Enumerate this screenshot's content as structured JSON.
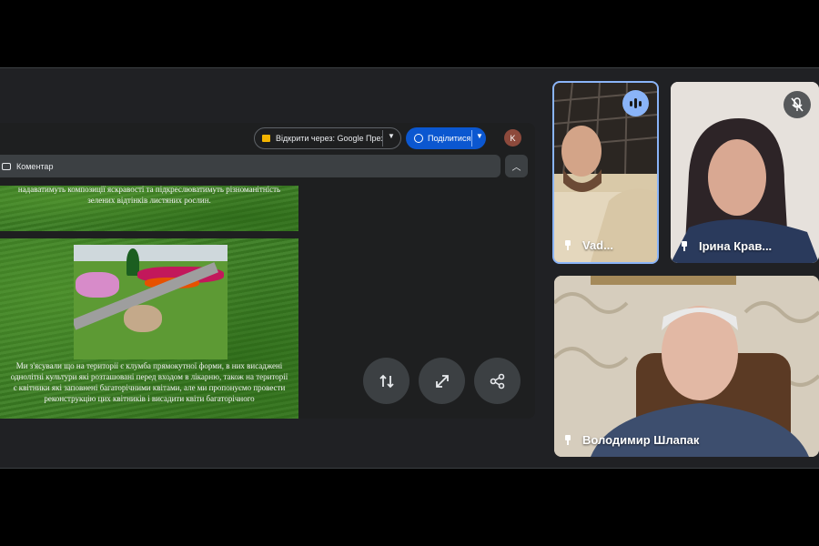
{
  "presentation": {
    "open_with_label": "Відкрити через: Google Презентації",
    "share_label": "Поділитися",
    "account_initial": "K",
    "comment_label": "Коментар",
    "slide1_text": "надаватимуть композиції яскравості та підкреслюватимуть різноманітність зелених відтінків листяних рослин.",
    "slide2_text": "Ми з'ясували що на території є клумба прямокутної форми, в них висаджені однолітні культури які розташовані перед входом в лікарню, також на території є квітники які заповнені багаторічними квітами, але ми пропонуємо провести реконструкцію цих квітників і висадити квіти багаторічного",
    "actions": [
      "swap-icon",
      "fullscreen-icon",
      "share-icon"
    ]
  },
  "participants": [
    {
      "name": "Vad...",
      "state": "speaking"
    },
    {
      "name": "Ірина Крав...",
      "state": "muted"
    },
    {
      "name": "Володимир Шлапак",
      "state": "unmuted"
    }
  ],
  "colors": {
    "accent": "#8ab4f8",
    "share_button": "#0b57d0",
    "tile_bg": "#202124"
  }
}
